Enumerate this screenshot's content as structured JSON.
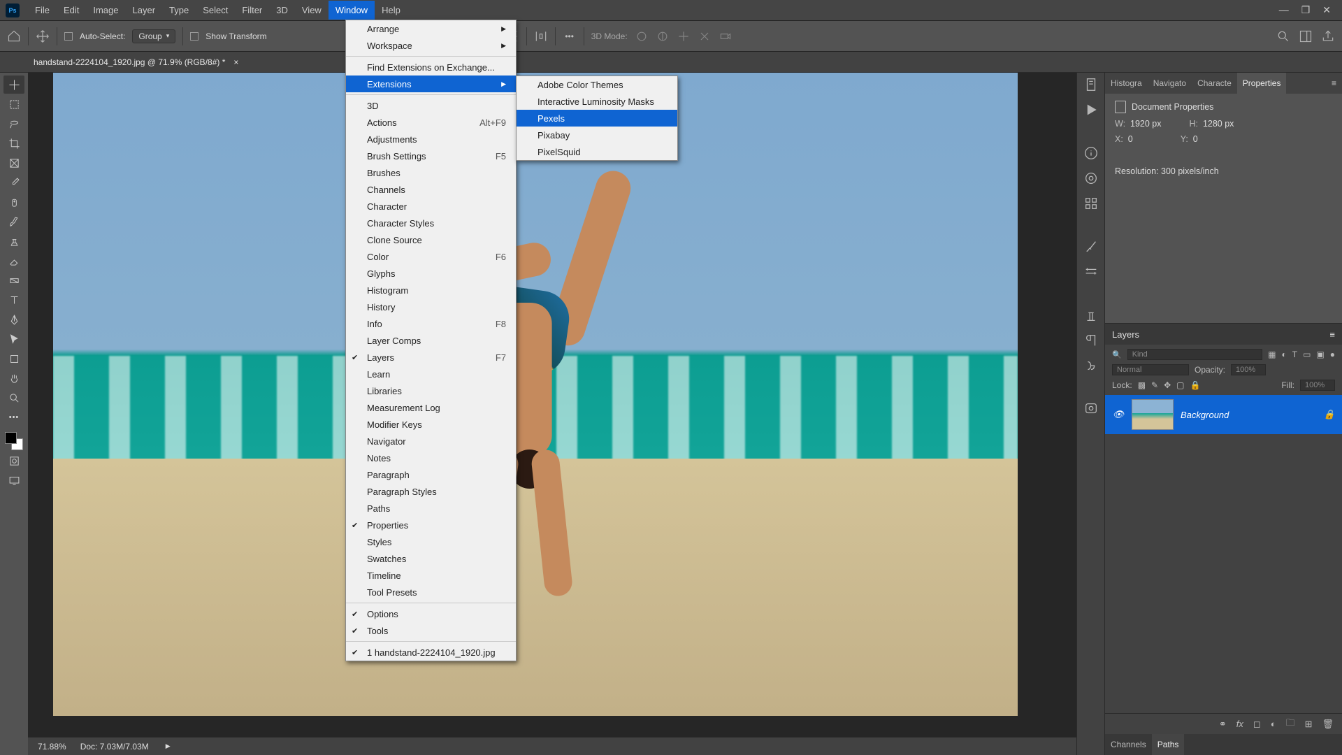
{
  "menubar": {
    "items": [
      "File",
      "Edit",
      "Image",
      "Layer",
      "Type",
      "Select",
      "Filter",
      "3D",
      "View",
      "Window",
      "Help"
    ],
    "active": "Window",
    "app_badge": "Ps"
  },
  "win_controls": {
    "minimize": "—",
    "maximize": "❐",
    "close": "✕"
  },
  "options_bar": {
    "auto_select": "Auto-Select:",
    "group": "Group",
    "show_transform": "Show Transform",
    "mode_3d": "3D Mode:"
  },
  "doc_tab": {
    "title": "handstand-2224104_1920.jpg @ 71.9% (RGB/8#) *"
  },
  "window_menu": {
    "items": [
      {
        "label": "Arrange",
        "sub": true
      },
      {
        "label": "Workspace",
        "sub": true
      },
      {
        "sep": true
      },
      {
        "label": "Find Extensions on Exchange..."
      },
      {
        "label": "Extensions",
        "sub": true,
        "hl": true
      },
      {
        "sep": true
      },
      {
        "label": "3D"
      },
      {
        "label": "Actions",
        "shortcut": "Alt+F9"
      },
      {
        "label": "Adjustments"
      },
      {
        "label": "Brush Settings",
        "shortcut": "F5"
      },
      {
        "label": "Brushes"
      },
      {
        "label": "Channels"
      },
      {
        "label": "Character"
      },
      {
        "label": "Character Styles"
      },
      {
        "label": "Clone Source"
      },
      {
        "label": "Color",
        "shortcut": "F6"
      },
      {
        "label": "Glyphs"
      },
      {
        "label": "Histogram"
      },
      {
        "label": "History"
      },
      {
        "label": "Info",
        "shortcut": "F8"
      },
      {
        "label": "Layer Comps"
      },
      {
        "label": "Layers",
        "shortcut": "F7",
        "check": true
      },
      {
        "label": "Learn"
      },
      {
        "label": "Libraries"
      },
      {
        "label": "Measurement Log"
      },
      {
        "label": "Modifier Keys"
      },
      {
        "label": "Navigator"
      },
      {
        "label": "Notes"
      },
      {
        "label": "Paragraph"
      },
      {
        "label": "Paragraph Styles"
      },
      {
        "label": "Paths"
      },
      {
        "label": "Properties",
        "check": true
      },
      {
        "label": "Styles"
      },
      {
        "label": "Swatches"
      },
      {
        "label": "Timeline"
      },
      {
        "label": "Tool Presets"
      },
      {
        "sep": true
      },
      {
        "label": "Options",
        "check": true
      },
      {
        "label": "Tools",
        "check": true
      },
      {
        "sep": true
      },
      {
        "label": "1 handstand-2224104_1920.jpg",
        "check": true
      }
    ]
  },
  "ext_menu": {
    "items": [
      {
        "label": "Adobe Color Themes"
      },
      {
        "label": "Interactive Luminosity Masks"
      },
      {
        "label": "Pexels",
        "hl": true
      },
      {
        "label": "Pixabay"
      },
      {
        "label": "PixelSquid"
      }
    ]
  },
  "properties": {
    "title": "Document Properties",
    "w_label": "W:",
    "w_val": "1920 px",
    "h_label": "H:",
    "h_val": "1280 px",
    "x_label": "X:",
    "x_val": "0",
    "y_label": "Y:",
    "y_val": "0",
    "res": "Resolution: 300 pixels/inch",
    "tabs": [
      "Histogra",
      "Navigato",
      "Characte",
      "Properties"
    ]
  },
  "layers": {
    "title": "Layers",
    "kind_placeholder": "Kind",
    "blend": "Normal",
    "opacity_label": "Opacity:",
    "opacity_val": "100%",
    "lock_label": "Lock:",
    "fill_label": "Fill:",
    "fill_val": "100%",
    "layer_name": "Background",
    "bottom_tabs": [
      "Channels",
      "Paths"
    ]
  },
  "status": {
    "zoom": "71.88%",
    "doc": "Doc: 7.03M/7.03M"
  }
}
